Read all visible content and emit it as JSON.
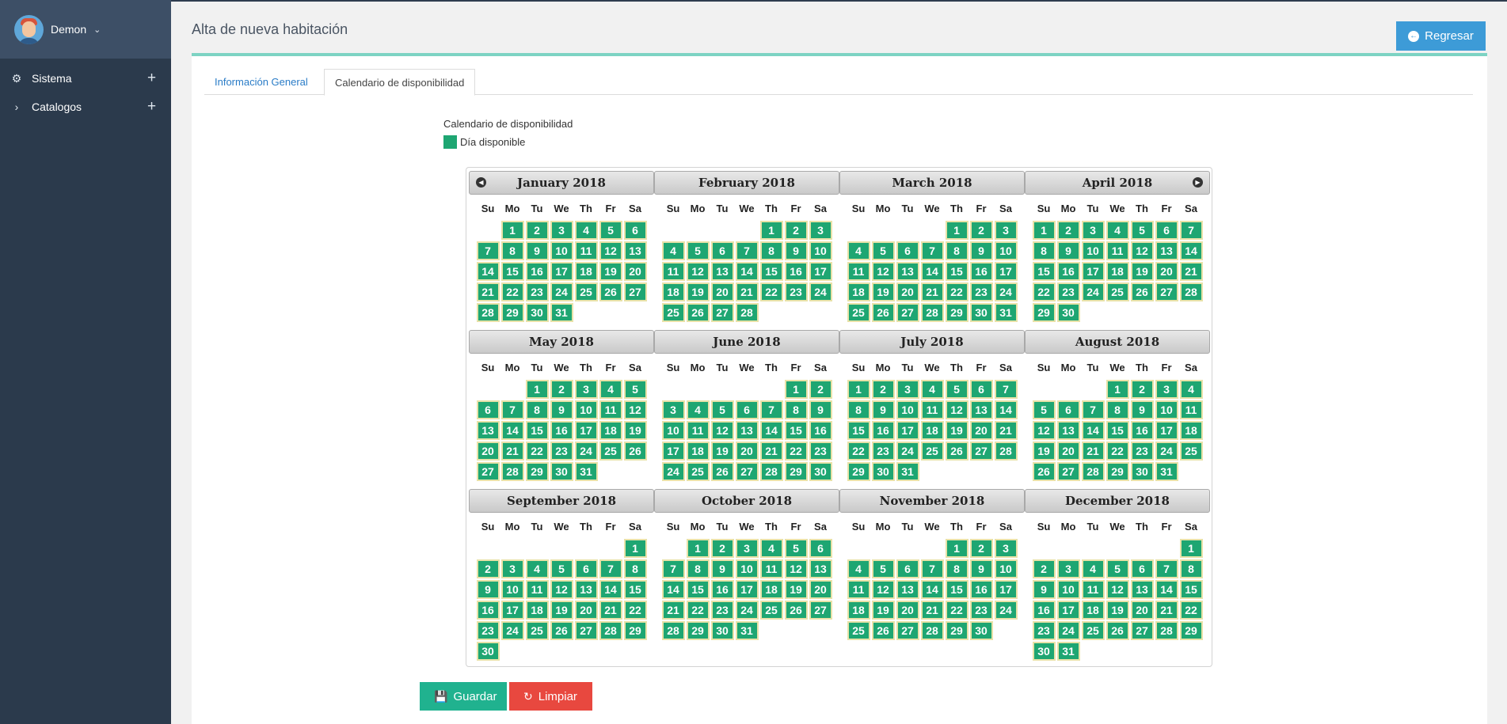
{
  "user": {
    "name": "Demon"
  },
  "sidebar": {
    "items": [
      {
        "label": "Sistema",
        "icon": "gear-icon"
      },
      {
        "label": "Catalogos",
        "icon": "chevron-right-icon"
      }
    ]
  },
  "header": {
    "title": "Alta de nueva habitación",
    "back_label": "Regresar"
  },
  "tabs": [
    {
      "label": "Información General"
    },
    {
      "label": "Calendario de disponibilidad"
    }
  ],
  "calendar": {
    "label": "Calendario de disponibilidad",
    "legend_label": "Día disponible",
    "available_color": "#1ea672",
    "weekday_labels": [
      "Su",
      "Mo",
      "Tu",
      "We",
      "Th",
      "Fr",
      "Sa"
    ],
    "months": [
      {
        "title": "January 2018",
        "first_weekday": 1,
        "days": 31
      },
      {
        "title": "February 2018",
        "first_weekday": 4,
        "days": 28
      },
      {
        "title": "March 2018",
        "first_weekday": 4,
        "days": 31
      },
      {
        "title": "April 2018",
        "first_weekday": 0,
        "days": 30
      },
      {
        "title": "May 2018",
        "first_weekday": 2,
        "days": 31
      },
      {
        "title": "June 2018",
        "first_weekday": 5,
        "days": 30
      },
      {
        "title": "July 2018",
        "first_weekday": 0,
        "days": 31
      },
      {
        "title": "August 2018",
        "first_weekday": 3,
        "days": 31
      },
      {
        "title": "September 2018",
        "first_weekday": 6,
        "days": 30
      },
      {
        "title": "October 2018",
        "first_weekday": 1,
        "days": 31
      },
      {
        "title": "November 2018",
        "first_weekday": 4,
        "days": 30
      },
      {
        "title": "December 2018",
        "first_weekday": 6,
        "days": 31
      }
    ]
  },
  "actions": {
    "save_label": "Guardar",
    "clear_label": "Limpiar"
  }
}
